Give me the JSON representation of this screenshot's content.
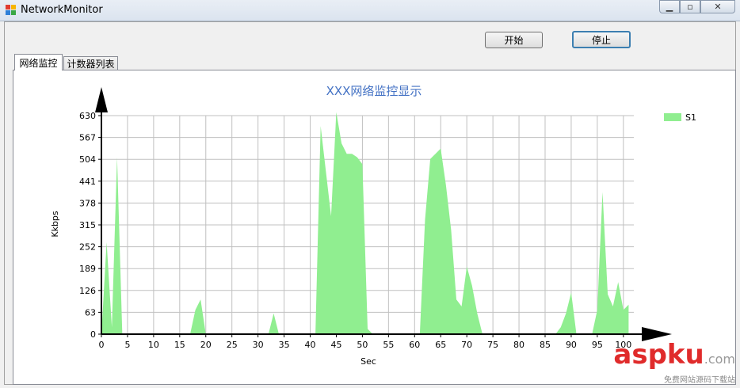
{
  "window": {
    "title": "NetworkMonitor"
  },
  "toolbar": {
    "start_label": "开始",
    "stop_label": "停止"
  },
  "tabs": [
    {
      "label": "网络监控",
      "active": true
    },
    {
      "label": "计数器列表",
      "active": false
    }
  ],
  "colors": {
    "series": "#90ee90",
    "title": "#4472c4",
    "grid": "#c0c0c0"
  },
  "watermark": {
    "brand": "aspku",
    "domain": ".com",
    "subtitle": "免费网站源码下载站"
  },
  "chart_data": {
    "type": "area",
    "title": "XXX网络监控显示",
    "xlabel": "Sec",
    "ylabel": "Kkbps",
    "xlim": [
      0,
      102
    ],
    "ylim": [
      0,
      630
    ],
    "x_ticks": [
      0,
      5,
      10,
      15,
      20,
      25,
      30,
      35,
      40,
      45,
      50,
      55,
      60,
      65,
      70,
      75,
      80,
      85,
      90,
      95,
      100
    ],
    "y_ticks": [
      0,
      63,
      126,
      189,
      252,
      315,
      378,
      441,
      504,
      567,
      630
    ],
    "grid": true,
    "legend": "top-right",
    "series": [
      {
        "name": "S1",
        "color": "#90ee90",
        "points": [
          [
            0,
            0
          ],
          [
            1,
            265
          ],
          [
            2,
            20
          ],
          [
            3,
            510
          ],
          [
            4,
            0
          ],
          [
            5,
            0
          ],
          [
            17,
            0
          ],
          [
            18,
            70
          ],
          [
            19,
            100
          ],
          [
            20,
            0
          ],
          [
            32,
            0
          ],
          [
            33,
            60
          ],
          [
            34,
            0
          ],
          [
            41,
            0
          ],
          [
            42,
            600
          ],
          [
            43,
            470
          ],
          [
            44,
            340
          ],
          [
            45,
            640
          ],
          [
            46,
            550
          ],
          [
            47,
            520
          ],
          [
            48,
            520
          ],
          [
            49,
            510
          ],
          [
            50,
            490
          ],
          [
            51,
            15
          ],
          [
            52,
            0
          ],
          [
            61,
            0
          ],
          [
            62,
            330
          ],
          [
            63,
            505
          ],
          [
            64,
            520
          ],
          [
            65,
            535
          ],
          [
            66,
            430
          ],
          [
            67,
            300
          ],
          [
            68,
            100
          ],
          [
            69,
            80
          ],
          [
            70,
            195
          ],
          [
            71,
            140
          ],
          [
            72,
            60
          ],
          [
            73,
            0
          ],
          [
            87,
            0
          ],
          [
            88,
            20
          ],
          [
            89,
            60
          ],
          [
            90,
            120
          ],
          [
            91,
            0
          ],
          [
            94,
            0
          ],
          [
            95,
            70
          ],
          [
            96,
            410
          ],
          [
            97,
            115
          ],
          [
            98,
            80
          ],
          [
            99,
            150
          ],
          [
            100,
            70
          ],
          [
            101,
            85
          ]
        ]
      }
    ]
  }
}
